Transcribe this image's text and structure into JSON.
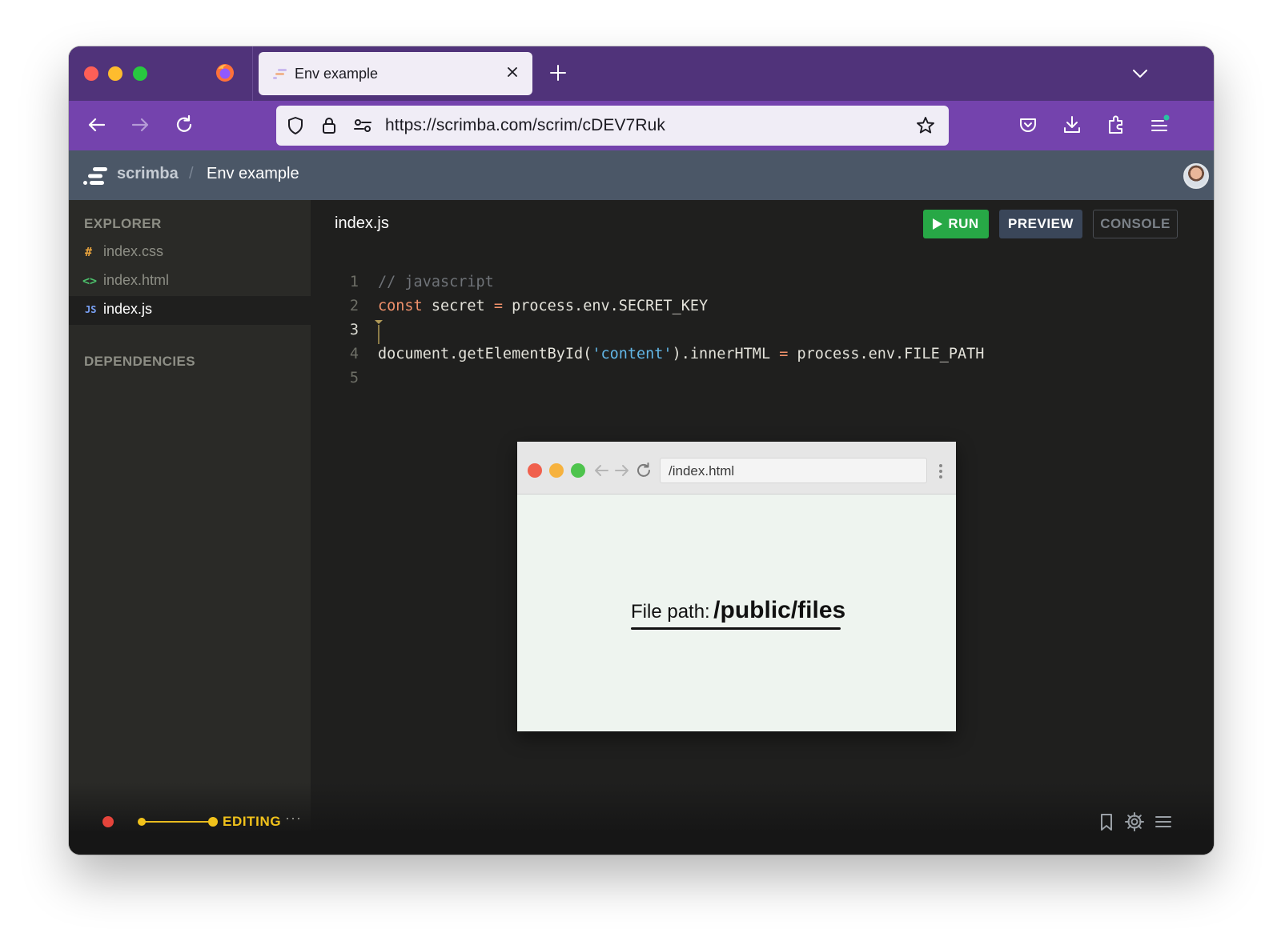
{
  "browser": {
    "tab_title": "Env example",
    "url": "https://scrimba.com/scrim/cDEV7Ruk"
  },
  "app": {
    "brand": "scrimba",
    "separator": "/",
    "project_title": "Env example"
  },
  "sidebar": {
    "explorer_heading": "EXPLORER",
    "files": [
      {
        "icon": "#",
        "label": "index.css",
        "icon_color": "#e8a33c"
      },
      {
        "icon": "<>",
        "label": "index.html",
        "icon_color": "#4cbf6b"
      },
      {
        "icon": "JS",
        "label": "index.js",
        "icon_color": "#7aa2f7"
      }
    ],
    "dependencies_heading": "DEPENDENCIES"
  },
  "editor": {
    "file_title": "index.js",
    "run_label": "RUN",
    "preview_label": "PREVIEW",
    "console_label": "CONSOLE",
    "line_numbers": [
      "1",
      "2",
      "3",
      "4",
      "5"
    ],
    "code": {
      "l1_comment": "// javascript",
      "l2_kw": "const",
      "l2_a": " secret ",
      "l2_op": "=",
      "l2_b": " process.env.SECRET_KEY",
      "l4_a": "document.getElementById(",
      "l4_str": "'content'",
      "l4_b": ").innerHTML ",
      "l4_op": "=",
      "l4_c": " process.env.FILE_PATH"
    }
  },
  "preview": {
    "url": "/index.html",
    "label": "File path:",
    "value": "/public/files"
  },
  "bottombar": {
    "mode": "EDITING",
    "more": "···"
  },
  "colors": {
    "tabstrip": "#50337a",
    "navbar": "#7443ad",
    "header": "#4b5767",
    "run": "#27a846",
    "editing": "#f1c21b"
  }
}
